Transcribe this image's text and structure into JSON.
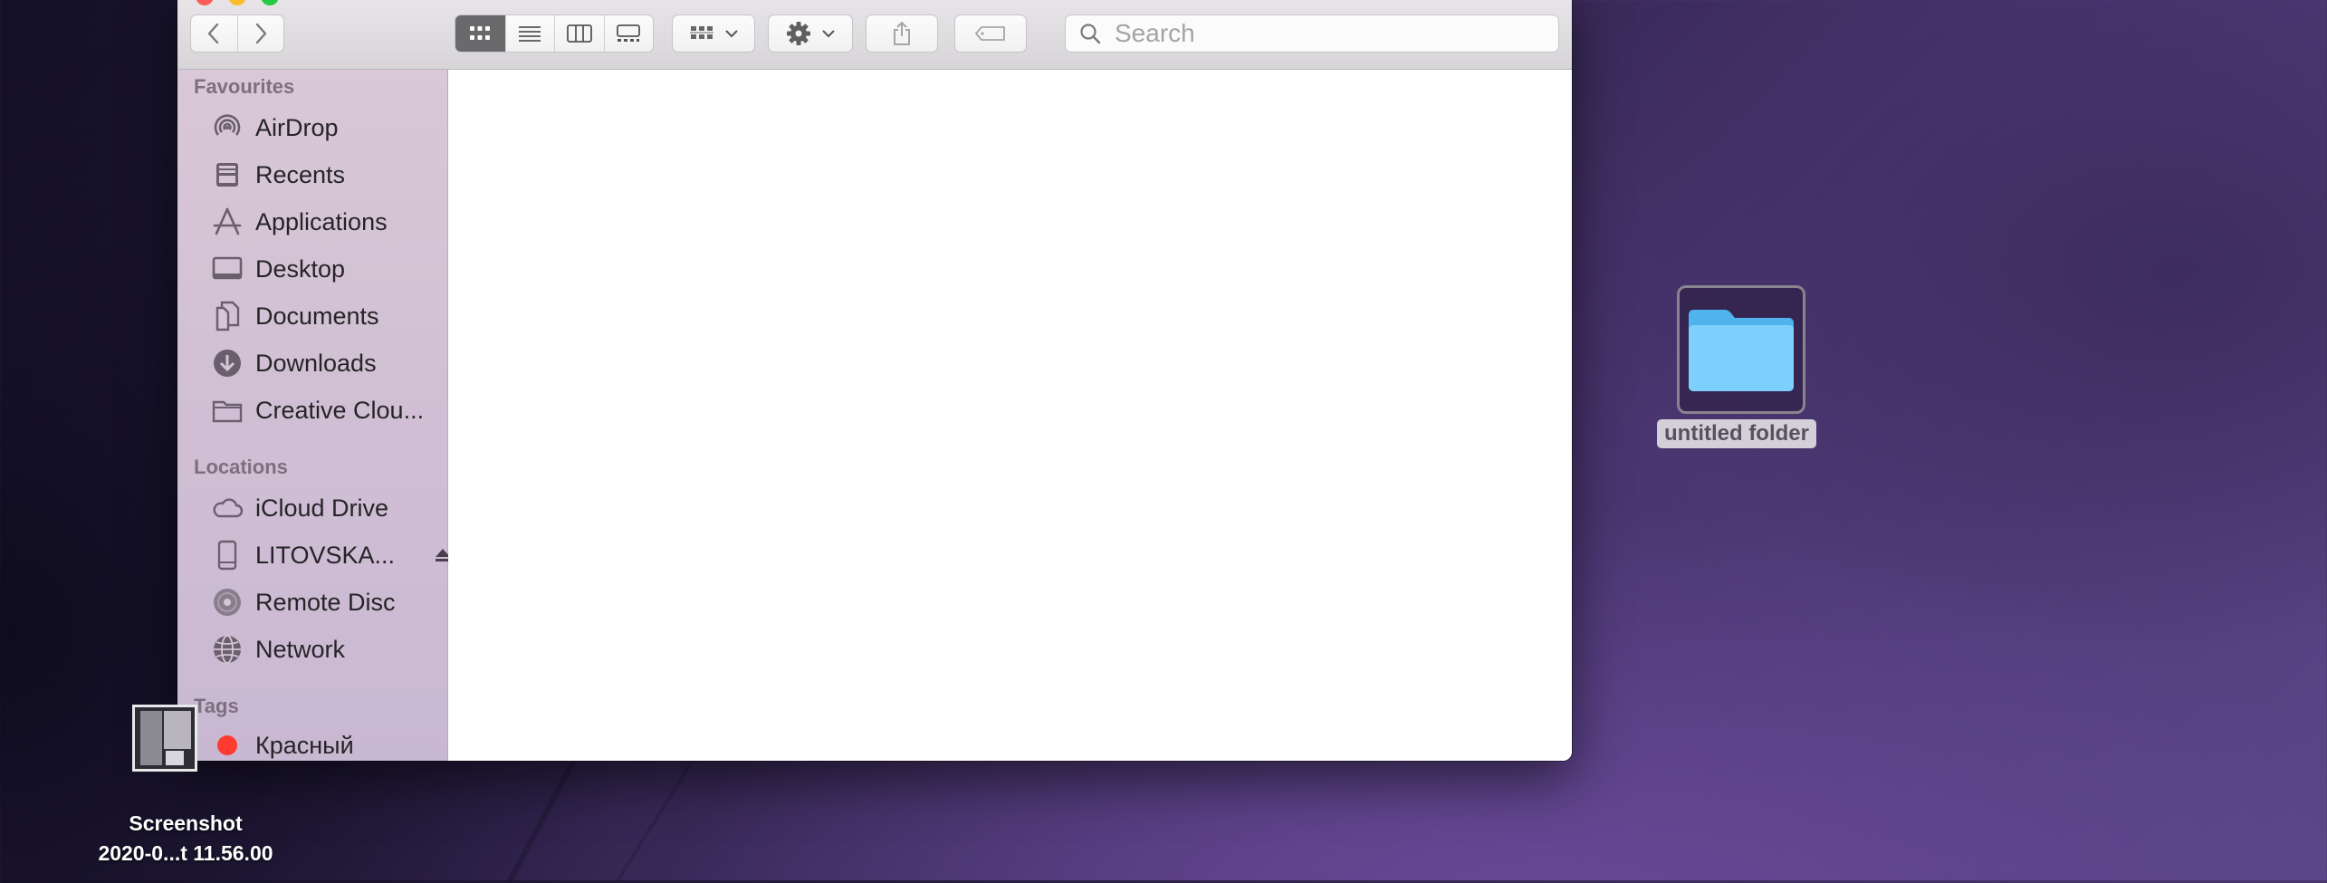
{
  "finder": {
    "toolbar": {
      "back_icon": "chevron-left-icon",
      "forward_icon": "chevron-right-icon",
      "view_modes": [
        "icon-view",
        "list-view",
        "column-view",
        "gallery-view"
      ],
      "active_view": "icon-view",
      "search_placeholder": "Search"
    },
    "sidebar": {
      "favourites_heading": "Favourites",
      "favourites": [
        {
          "label": "AirDrop",
          "icon": "airdrop-icon"
        },
        {
          "label": "Recents",
          "icon": "recents-icon"
        },
        {
          "label": "Applications",
          "icon": "applications-icon"
        },
        {
          "label": "Desktop",
          "icon": "desktop-icon"
        },
        {
          "label": "Documents",
          "icon": "documents-icon"
        },
        {
          "label": "Downloads",
          "icon": "downloads-icon"
        },
        {
          "label": "Creative Clou...",
          "icon": "folder-icon"
        }
      ],
      "locations_heading": "Locations",
      "locations": [
        {
          "label": "iCloud Drive",
          "icon": "icloud-icon"
        },
        {
          "label": "LITOVSKA...",
          "icon": "drive-icon"
        },
        {
          "label": "Remote Disc",
          "icon": "disc-icon"
        },
        {
          "label": "Network",
          "icon": "network-icon"
        }
      ],
      "tags_heading": "Tags",
      "tags": [
        {
          "label": "Красный",
          "color": "#ff3b30"
        }
      ]
    }
  },
  "desktop": {
    "folder_label": "untitled folder",
    "screenshot_label_line1": "Screenshot",
    "screenshot_label_line2": "2020-0...t 11.56.00"
  }
}
